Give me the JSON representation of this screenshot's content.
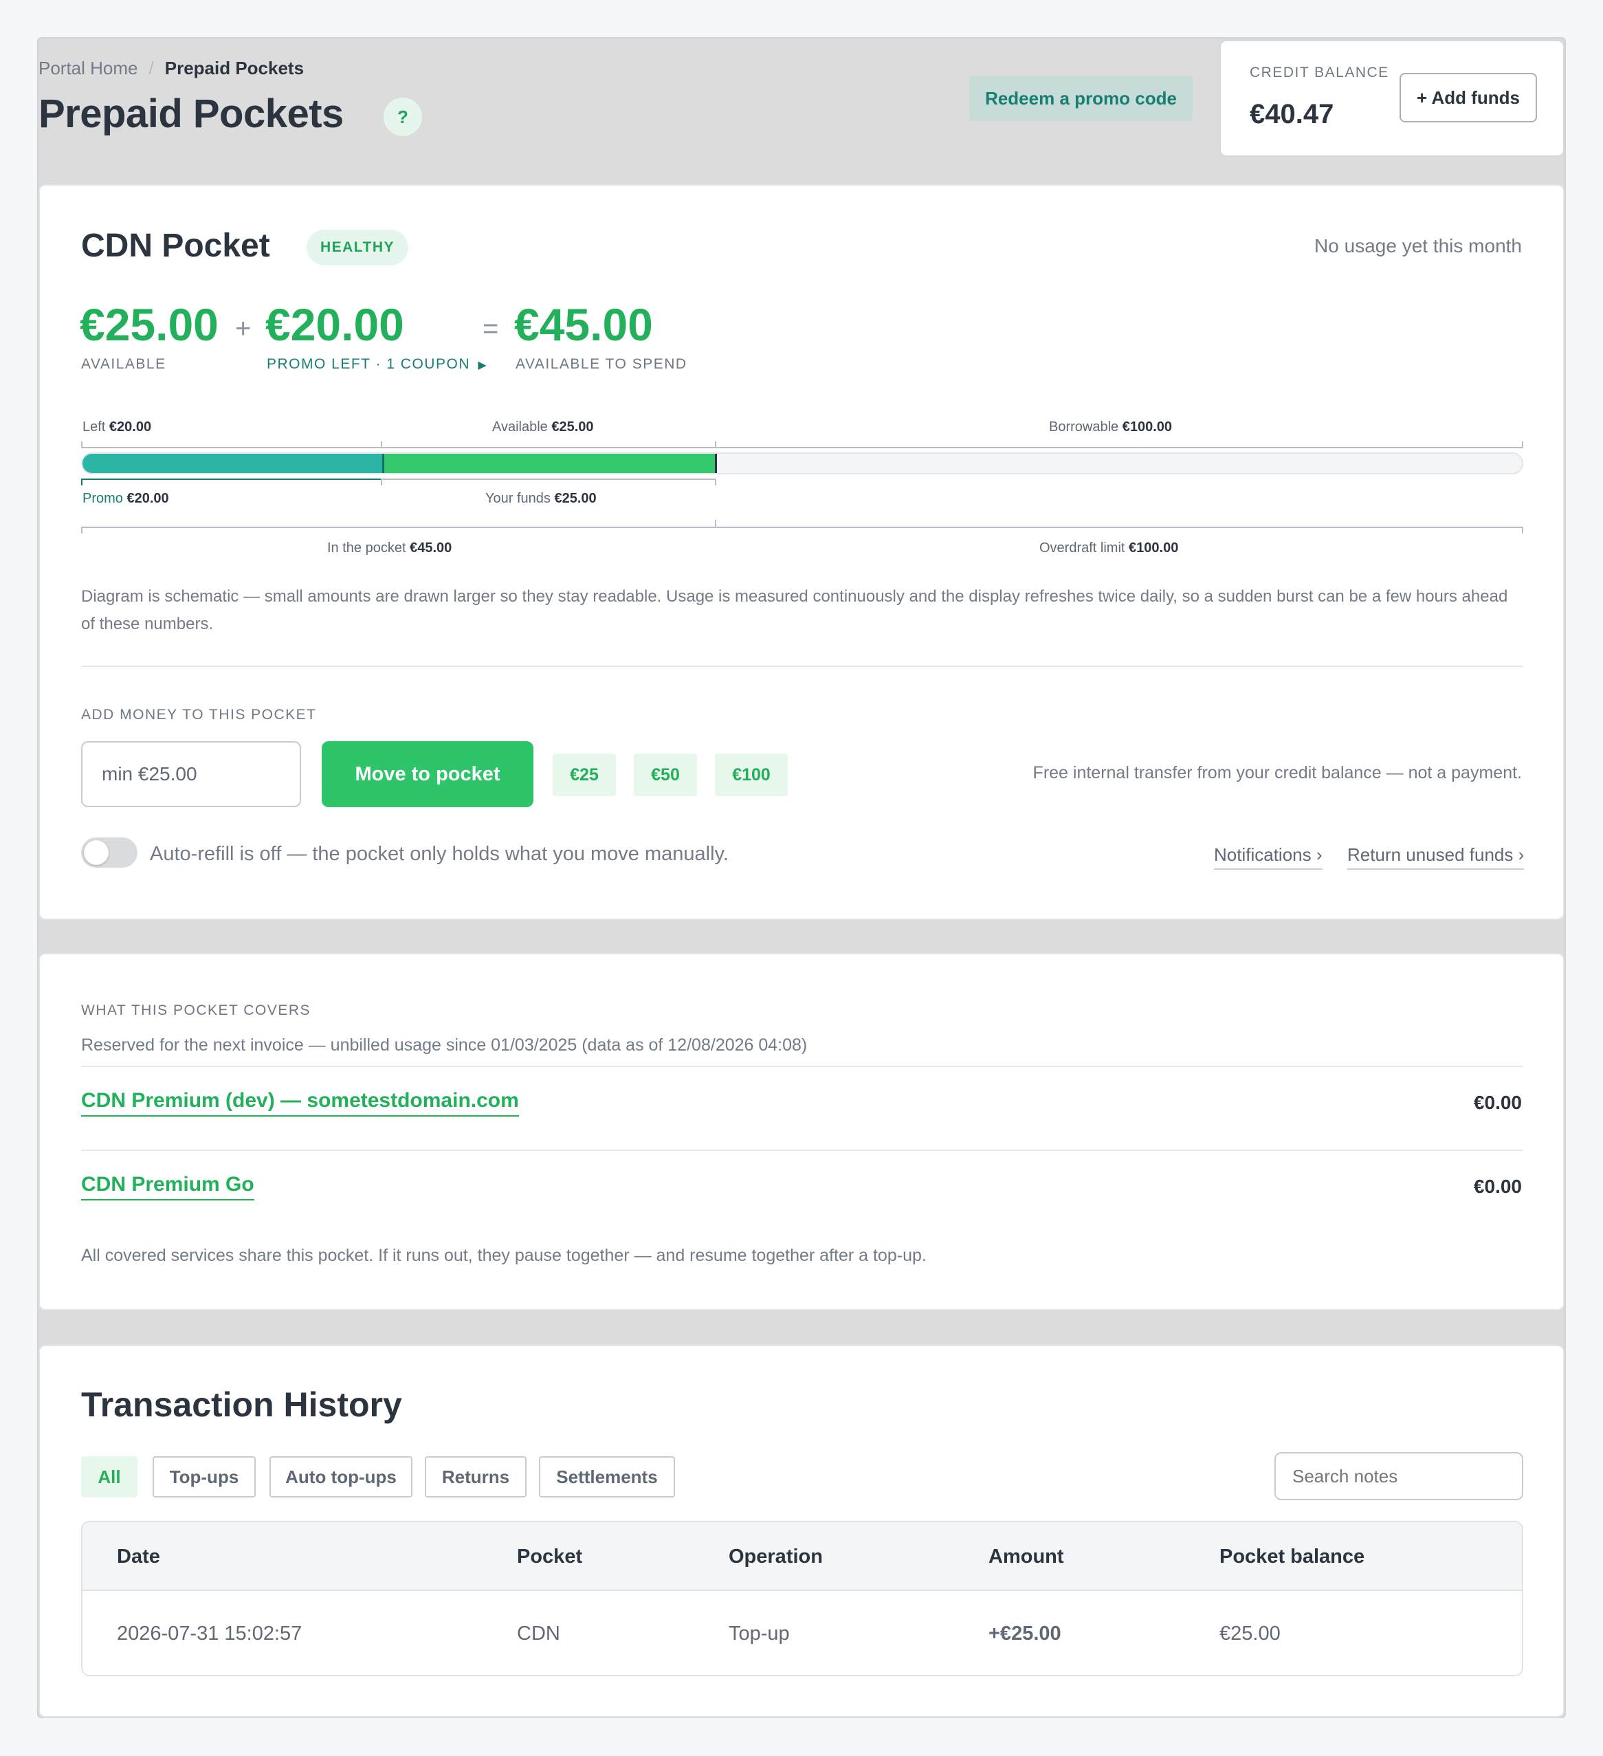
{
  "breadcrumb": {
    "home": "Portal Home",
    "separator": "/",
    "current": "Prepaid Pockets"
  },
  "header": {
    "title": "Prepaid Pockets",
    "help_label": "?",
    "promo_button": "Redeem a promo code",
    "credit": {
      "label": "CREDIT BALANCE",
      "value": "€40.47",
      "add_funds": "+ Add funds"
    }
  },
  "pocket": {
    "title": "CDN Pocket",
    "status": "HEALTHY",
    "usage_note": "No usage yet this month",
    "summary": {
      "available": {
        "value": "€25.00",
        "label": "AVAILABLE"
      },
      "plus": "+",
      "promo": {
        "value": "€20.00",
        "label": "PROMO LEFT · 1 COUPON"
      },
      "equals": "=",
      "total": {
        "value": "€45.00",
        "label": "AVAILABLE TO SPEND"
      }
    },
    "bar": {
      "top": {
        "left_label": "Left",
        "left_value": "€20.00",
        "available_label": "Available",
        "available_value": "€25.00",
        "borrowable_label": "Borrowable",
        "borrowable_value": "€100.00"
      },
      "bottom": {
        "promo_label": "Promo",
        "promo_value": "€20.00",
        "funds_label": "Your funds",
        "funds_value": "€25.00"
      },
      "totals": {
        "pocket_label": "In the pocket",
        "pocket_value": "€45.00",
        "overdraft_label": "Overdraft limit",
        "overdraft_value": "€100.00"
      },
      "colors": {
        "promo": "#2bb5a5",
        "funds": "#34c96d",
        "empty": "#f4f5f6"
      }
    },
    "diagram_note": "Diagram is schematic — small amounts are drawn larger so they stay readable. Usage is measured continuously and the display refreshes twice daily, so a sudden burst can be a few hours ahead of these numbers.",
    "add_money": {
      "label": "ADD MONEY TO THIS POCKET",
      "placeholder": "min €25.00",
      "button": "Move to pocket",
      "chips": [
        "€25",
        "€50",
        "€100"
      ],
      "note": "Free internal transfer from your credit balance — not a payment."
    },
    "autorefill_text": "Auto-refill is off — the pocket only holds what you move manually.",
    "notifications_link": "Notifications ›",
    "return_link": "Return unused funds ›"
  },
  "covers": {
    "label": "WHAT THIS POCKET COVERS",
    "subtitle": "Reserved for the next invoice — unbilled usage since 01/03/2025 (data as of 12/08/2026 04:08)",
    "items": [
      {
        "name": "CDN Premium (dev) — sometestdomain.com",
        "amount": "€0.00"
      },
      {
        "name": "CDN Premium Go",
        "amount": "€0.00"
      }
    ],
    "note": "All covered services share this pocket. If it runs out, they pause together — and resume together after a top-up."
  },
  "history": {
    "title": "Transaction History",
    "filters": [
      "All",
      "Top-ups",
      "Auto top-ups",
      "Returns",
      "Settlements"
    ],
    "search_placeholder": "Search notes",
    "columns": [
      "Date",
      "Pocket",
      "Operation",
      "Amount",
      "Pocket balance"
    ],
    "rows": [
      {
        "date": "2026-07-31 15:02:57",
        "pocket": "CDN",
        "operation": "Top-up",
        "amount": "+€25.00",
        "balance": "€25.00"
      }
    ]
  }
}
